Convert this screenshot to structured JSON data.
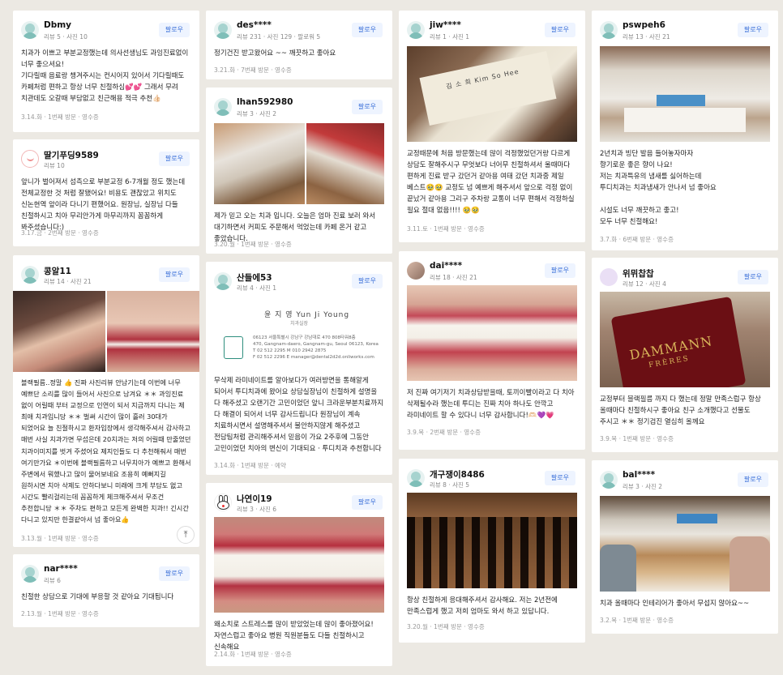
{
  "follow_label": "팔로우",
  "reviews": {
    "c1r1": {
      "name": "Dbmy",
      "stats": "리뷰 5 · 사진 10",
      "text": "치과가 이쁘고 부분교정했는데 의사선생님도 과잉진료없이 너무 좋으셔요!\n기다릴때 음료랑 챙겨주시는 컨시어지 있어서 기다릴때도 카페처럼 편하고 항상 너무 친절하심💕💕 그래서 무려 치관데도 오갈때 부담없고 친근해용 적극 추천👍🏻",
      "meta": "3.14.화 · 1번째 방문 · 영수증"
    },
    "c1r2": {
      "name": "딸기푸딩9589",
      "stats": "리뷰 10",
      "text": "앞니가 벌어져서 섬측으로 부분교정 6-7개월 정도 했는데 전체교정한 것 처럼 잘됐어요! 비용도 괜찮았고 위치도 신논현역 앞이라 다니기 편했어요. 원장님, 실장님 다들 친절하시고 치아 무리안가게 마무리까지 꼼꼼하게 봐주셨습니다:)",
      "meta": "3.17.금 · 2번째 방문 · 영수증"
    },
    "c1r3": {
      "name": "콩알11",
      "stats": "리뷰 14 · 사진 21",
      "text": "블랙필름..정말 👍 진짜 사진리뷰 안남기는데 이번에 너무 예쁘단 소리를 많이 들어서 사진으로 남겨요 ＊＊ 과잉진료 없이 어릴때 부터 교정으로 인연이 되서 지금까지 다니는 제 최애 치과입니당 ＊＊ 벌써 시간이 많이 흘러 30대가 되었어요 늘 친절하시고 환자입장에서 생각해주셔서 감사하고 매번 사실 치과가면 무섭은데 20치과는 저의 어릴때 만줄었던 치과이미지를 벗겨 주셨어요 제지인들도 다 추천해줘서 매번 여기만가요 ＊이번에 블랙필름하고 너무치아가 예쁘고 환해서 주변에서 뭐했나고 많이 물어보네요 조용히 예뻐지길 원하시면 치아 삭제도 안하다보니 미래에 크게 부담도 없고 시간도 빨리걸리는데 꼼꼼하게 체크해주셔서 무조건 추천합니당 ＊＊ 주차도 편하고 모든게 완벽한 치과!! 긴시간 다니고 있지만 한결같아서 넘 좋아요👍",
      "meta": "3.13.월 · 1번째 방문 · 영수증"
    },
    "c1r4": {
      "name": "nar****",
      "stats": "리뷰 6",
      "text": "친절한 상담으로 기대에 부응할 것 같아요 기대됩니다",
      "meta": "2.13.월 · 1번째 방문 · 영수증"
    },
    "c2r1": {
      "name": "des****",
      "stats": "리뷰 231 · 사진 129 · 팔로워 5",
      "text": "정기건진 받고왔어요 ~~ 깨끗하고 좋아요",
      "meta": "3.21.화 · 7번째 방문 · 영수증"
    },
    "c2r2": {
      "name": "lhan592980",
      "stats": "리뷰 3 · 사진 2",
      "text": "제가 믿고 오는 치과 입니다. 오늘은 엄마 진료 보러 와서 대기하면서 커피도 주문해서 먹었는데 카페 온거 같고 좋았습니다.",
      "meta": "3.20.월 · 1번째 방문 · 영수증"
    },
    "c2r3": {
      "name": "산들에53",
      "stats": "리뷰 4 · 사진 1",
      "text": "무삭제 라미네이트를 알아보다가 여러방면을 통해알게 되어서 투디치과에 왔어요 상담실장님이 친절하게 설명을 다 해주셨고 오랜기간 고민이었던 앞니 크라운부분치료까지 다 해결이 되어서 너무 감사드립니다 원장님이 계속 치료하시면서 설명해주셔서 불안하지않게 해주셨고 전담팀처럼 관리해주셔서 믿음이 가요 2주후에 그동안 고민이었던 치아의 변신이 기대되요 · 투디치과 추천합니다",
      "meta": "3.14.화 · 1번째 방문 · 예약"
    },
    "c2r4": {
      "name": "나연이19",
      "stats": "리뷰 3 · 사진 6",
      "text": "왜소치로 스트레스를 많이 받았었는데 많이 좋아졌어요! 자연스럽고 좋아요 병원 직원분들도 다들 친절하시고 신속해요",
      "meta": "2.14.화 · 1번째 방문 · 영수증"
    },
    "c3r1": {
      "name": "jiw****",
      "stats": "리뷰 1 · 사진 1",
      "text": "교정때문에 처음 방문했는데 많이 걱정했었던거랑 다르게 상담도 잘해주시구 무엇보다 너어무 친절하셔서 울때마다 편하게 진료 받구 갔던거 같아용 여태 갔던 치과중 제일 베스트🥹🥹 교정도 넘 예쁘게 해주셔서 앞으로 걱정 없이 끝났거 같아용 그리구 주차랑 교통이 너무 편해서 걱정하실 필요 절대 없음!!!! 🥹🥹",
      "meta": "3.11.토 · 1번째 방문 · 영수증"
    },
    "c3r2": {
      "name": "dai****",
      "stats": "리뷰 18 · 사진 21",
      "text": "저 진짜 여기저기 치과상담받을때, 토끼이빨이라고 다 치아 삭제될수라 했는데 투디는 진짜 치아 하나도 안깍고 라미네이트 할 수 있다니 너무 감사합니다!🫶🏻💜💗",
      "meta": "3.9.목 · 2번째 방문 · 영수증"
    },
    "c3r3": {
      "name": "개구쟁이8486",
      "stats": "리뷰 8 · 사진 5",
      "text": "항상 친절하게 응대해주셔서 감사해요. 저는 2년전에 만족스럽게 했고 저희 엄마도 와서 하고 있답니다.",
      "meta": "3.20.월 · 1번째 방문 · 영수증"
    },
    "c4r1": {
      "name": "pswpeh6",
      "stats": "리뷰 13 · 사진 21",
      "text": "2년치과 빙단 발음 들어놓자마자\n향기로운 좋은 향이 나요!\n저는 치과특유의 냄새를 싫어하는데\n투디치과는 치과냄새가 안나서 넘 좋아요\n\n시설도 너무 깨끗하고 좋고!\n모두 너무 친절해요!",
      "meta": "3.7.화 · 6번째 방문 · 영수증"
    },
    "c4r2": {
      "name": "위뮈찹찹",
      "stats": "리뷰 12 · 사진 4",
      "text": "교정부터 블랙필름 까지 다 했는데 정말 만족스럽구 항상 올때마다 친절하시구 좋아요 친구 소개했다고 선물도 주시고 ＊＊ 정기검진 열심히 올께요",
      "meta": "3.9.목 · 1번째 방문 · 영수증"
    },
    "c4r3": {
      "name": "bal****",
      "stats": "리뷰 3 · 사진 2",
      "text": "치과 올때마다 인테리어가 좋아서 무섭지 않아요~~",
      "meta": "3.2.목 · 1번째 방문 · 영수증"
    }
  },
  "bizcard": {
    "name_line": "김 소 희  Kim So Hee",
    "card2_name": "윤 지 영  Yun Ji Young",
    "card2_role": "치과실장",
    "card2_addr": "06123 서울특별시 강남구 강남대로 470 808타워8층\n470, Gangnam-daero, Gangnam-gu, Seoul 06123, Korea\nT 02 512 2295   M 010 2942 2875\nF 02 512 2296   E manager@dental2d2d.onliworks.com"
  },
  "tin": {
    "brand": "DAMMANN",
    "sub": "FRÈRES"
  },
  "icons": {
    "scroll_top": "arrow-up-icon"
  }
}
